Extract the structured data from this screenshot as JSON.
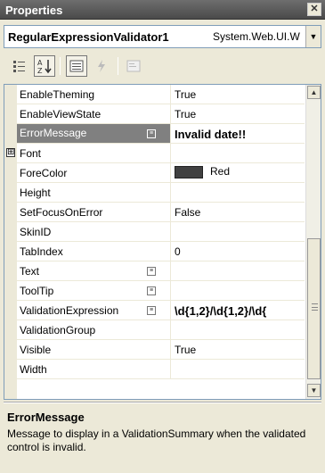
{
  "window": {
    "title": "Properties",
    "close_glyph": "✕"
  },
  "selector": {
    "object_name": "RegularExpressionValidator1",
    "object_type": "System.Web.UI.W",
    "dropdown_glyph": "▼"
  },
  "toolbar": {
    "categorized_icon": "categorized-icon",
    "alphabetical_icon": "sort-az-icon",
    "properties_icon": "properties-icon",
    "events_icon": "lightning-icon",
    "property_pages_icon": "property-pages-icon"
  },
  "properties": [
    {
      "name": "EnableTheming",
      "value": "True"
    },
    {
      "name": "EnableViewState",
      "value": "True"
    },
    {
      "name": "ErrorMessage",
      "value": "Invalid date!!",
      "selected": true,
      "ellipsis": "≡"
    },
    {
      "name": "Font",
      "value": "",
      "expander": "⊞"
    },
    {
      "name": "ForeColor",
      "value": "Red",
      "swatch_color": "#404040"
    },
    {
      "name": "Height",
      "value": ""
    },
    {
      "name": "SetFocusOnError",
      "value": "False"
    },
    {
      "name": "SkinID",
      "value": ""
    },
    {
      "name": "TabIndex",
      "value": "0"
    },
    {
      "name": "Text",
      "value": "",
      "ellipsis": "≡"
    },
    {
      "name": "ToolTip",
      "value": "",
      "ellipsis": "≡"
    },
    {
      "name": "ValidationExpression",
      "value": "\\d{1,2}/\\d{1,2}/\\d{",
      "ellipsis": "≡"
    },
    {
      "name": "ValidationGroup",
      "value": ""
    },
    {
      "name": "Visible",
      "value": "True"
    },
    {
      "name": "Width",
      "value": ""
    }
  ],
  "scrollbar": {
    "up_glyph": "▲",
    "down_glyph": "▼"
  },
  "description": {
    "title": "ErrorMessage",
    "text": "Message to display in a ValidationSummary when the validated control is invalid."
  }
}
